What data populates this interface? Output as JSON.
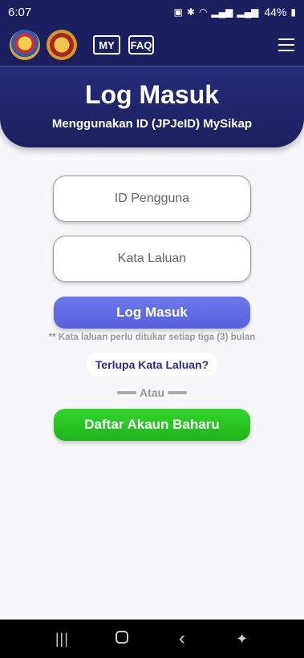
{
  "status_bar": {
    "time": "6:07",
    "battery": "44%"
  },
  "app_bar": {
    "badge_my": "MY",
    "badge_faq": "FAQ"
  },
  "header": {
    "title": "Log Masuk",
    "subtitle": "Menggunakan ID (JPJeID) MySikap"
  },
  "form": {
    "username_placeholder": "ID Pengguna",
    "password_placeholder": "Kata Laluan",
    "login_label": "Log Masuk",
    "note": "** Kata laluan perlu ditukar setiap tiga (3) bulan",
    "forgot_label": "Terlupa Kata Laluan?",
    "divider_label": "Atau",
    "register_label": "Daftar Akaun Baharu"
  },
  "colors": {
    "brand_navy": "#1b1f5f",
    "login_blue": "#5a64e0",
    "register_green": "#22c21f"
  },
  "icons": [
    "coat-of-arms-icon",
    "jpj-emblem-icon",
    "my-badge-icon",
    "faq-bubble-icon",
    "hamburger-menu-icon",
    "recents-icon",
    "home-icon",
    "back-icon",
    "accessibility-icon"
  ]
}
